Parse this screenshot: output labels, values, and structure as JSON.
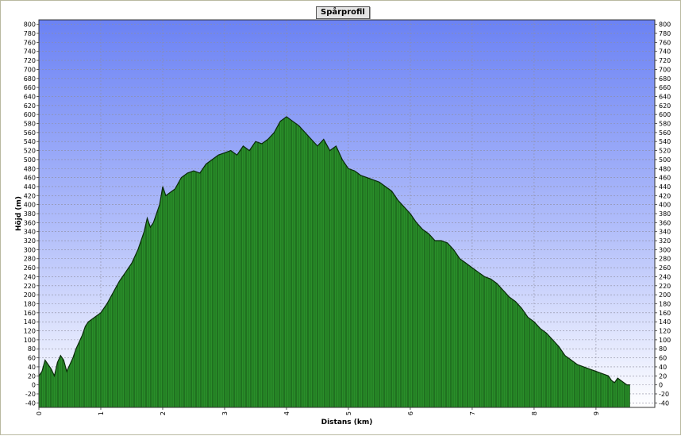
{
  "chart_data": {
    "type": "area",
    "title": "Spårprofil",
    "xlabel": "Distans (km)",
    "ylabel": "Höjd (m)",
    "xlim": [
      0,
      9.95
    ],
    "ylim": [
      -50,
      810
    ],
    "x_ticks": [
      0,
      1,
      2,
      3,
      4,
      5,
      6,
      7,
      8,
      9
    ],
    "y_ticks": [
      -40,
      -20,
      0,
      20,
      40,
      60,
      80,
      100,
      120,
      140,
      160,
      180,
      200,
      220,
      240,
      260,
      280,
      300,
      320,
      340,
      360,
      380,
      400,
      420,
      440,
      460,
      480,
      500,
      520,
      540,
      560,
      580,
      600,
      620,
      640,
      660,
      680,
      700,
      720,
      740,
      760,
      780,
      800
    ],
    "grid": true,
    "legend": "none",
    "colors": {
      "background_top": "#6b82f4",
      "background_bottom": "#ffffff",
      "fill": "#2a8f2a",
      "outline": "#0a2a0a",
      "grid": "#8e8ea0"
    },
    "series": [
      {
        "x": [
          0,
          0.05,
          0.1,
          0.15,
          0.2,
          0.25,
          0.3,
          0.35,
          0.4,
          0.45,
          0.5,
          0.55,
          0.6,
          0.65,
          0.7,
          0.75,
          0.8,
          0.85,
          0.9,
          1.0,
          1.1,
          1.2,
          1.3,
          1.4,
          1.5,
          1.6,
          1.7,
          1.75,
          1.8,
          1.85,
          1.9,
          1.95,
          2.0,
          2.05,
          2.1,
          2.2,
          2.3,
          2.4,
          2.5,
          2.6,
          2.7,
          2.8,
          2.9,
          3.0,
          3.1,
          3.2,
          3.3,
          3.4,
          3.5,
          3.6,
          3.7,
          3.8,
          3.9,
          4.0,
          4.1,
          4.2,
          4.3,
          4.4,
          4.5,
          4.6,
          4.7,
          4.8,
          4.9,
          5.0,
          5.1,
          5.15,
          5.2,
          5.3,
          5.4,
          5.5,
          5.6,
          5.7,
          5.8,
          5.9,
          6.0,
          6.1,
          6.2,
          6.3,
          6.4,
          6.5,
          6.6,
          6.7,
          6.8,
          6.9,
          7.0,
          7.1,
          7.2,
          7.3,
          7.4,
          7.5,
          7.6,
          7.7,
          7.8,
          7.9,
          8.0,
          8.1,
          8.2,
          8.3,
          8.4,
          8.5,
          8.6,
          8.7,
          8.8,
          8.9,
          9.0,
          9.1,
          9.2,
          9.25,
          9.3,
          9.35,
          9.4,
          9.45,
          9.5,
          9.55
        ],
        "y": [
          20,
          30,
          55,
          45,
          35,
          20,
          50,
          65,
          55,
          30,
          45,
          60,
          80,
          95,
          110,
          130,
          140,
          145,
          150,
          160,
          180,
          205,
          230,
          250,
          270,
          300,
          340,
          370,
          350,
          360,
          380,
          400,
          440,
          420,
          425,
          435,
          460,
          470,
          475,
          470,
          490,
          500,
          510,
          515,
          520,
          510,
          530,
          520,
          540,
          535,
          545,
          560,
          585,
          595,
          585,
          575,
          560,
          545,
          530,
          545,
          520,
          530,
          500,
          480,
          475,
          470,
          465,
          460,
          455,
          450,
          440,
          430,
          410,
          395,
          380,
          360,
          345,
          335,
          320,
          320,
          315,
          300,
          280,
          270,
          260,
          250,
          240,
          235,
          225,
          210,
          195,
          185,
          170,
          150,
          140,
          125,
          115,
          100,
          85,
          65,
          55,
          45,
          40,
          35,
          30,
          25,
          20,
          10,
          5,
          15,
          10,
          5,
          0,
          0
        ]
      }
    ]
  }
}
